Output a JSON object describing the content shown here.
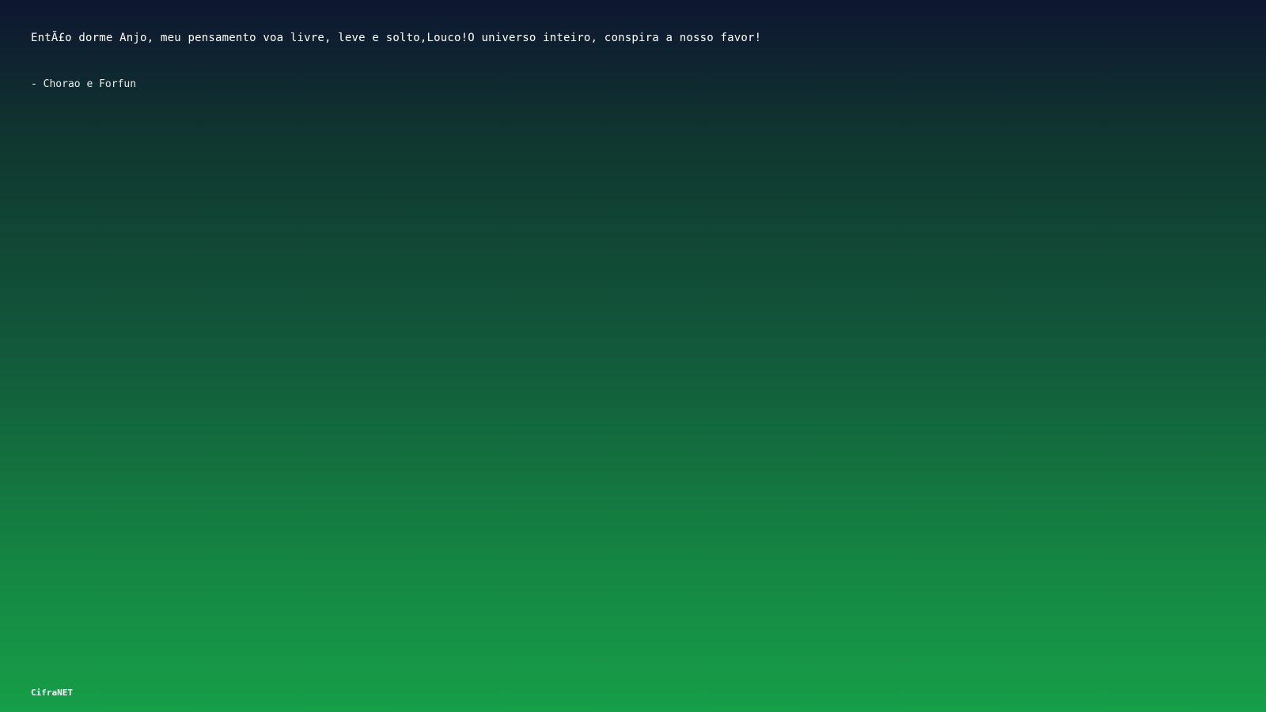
{
  "quote": {
    "text": "EntÃ£o dorme Anjo, meu pensamento voa livre, leve e solto,Louco!O universo inteiro, conspira a nosso favor!",
    "author": "- Chorao e Forfun"
  },
  "footer": {
    "brand": "CifraNET"
  },
  "colors": {
    "gradient_top": "#0e1630",
    "gradient_bottom": "#169e48",
    "text": "#ffffff"
  }
}
